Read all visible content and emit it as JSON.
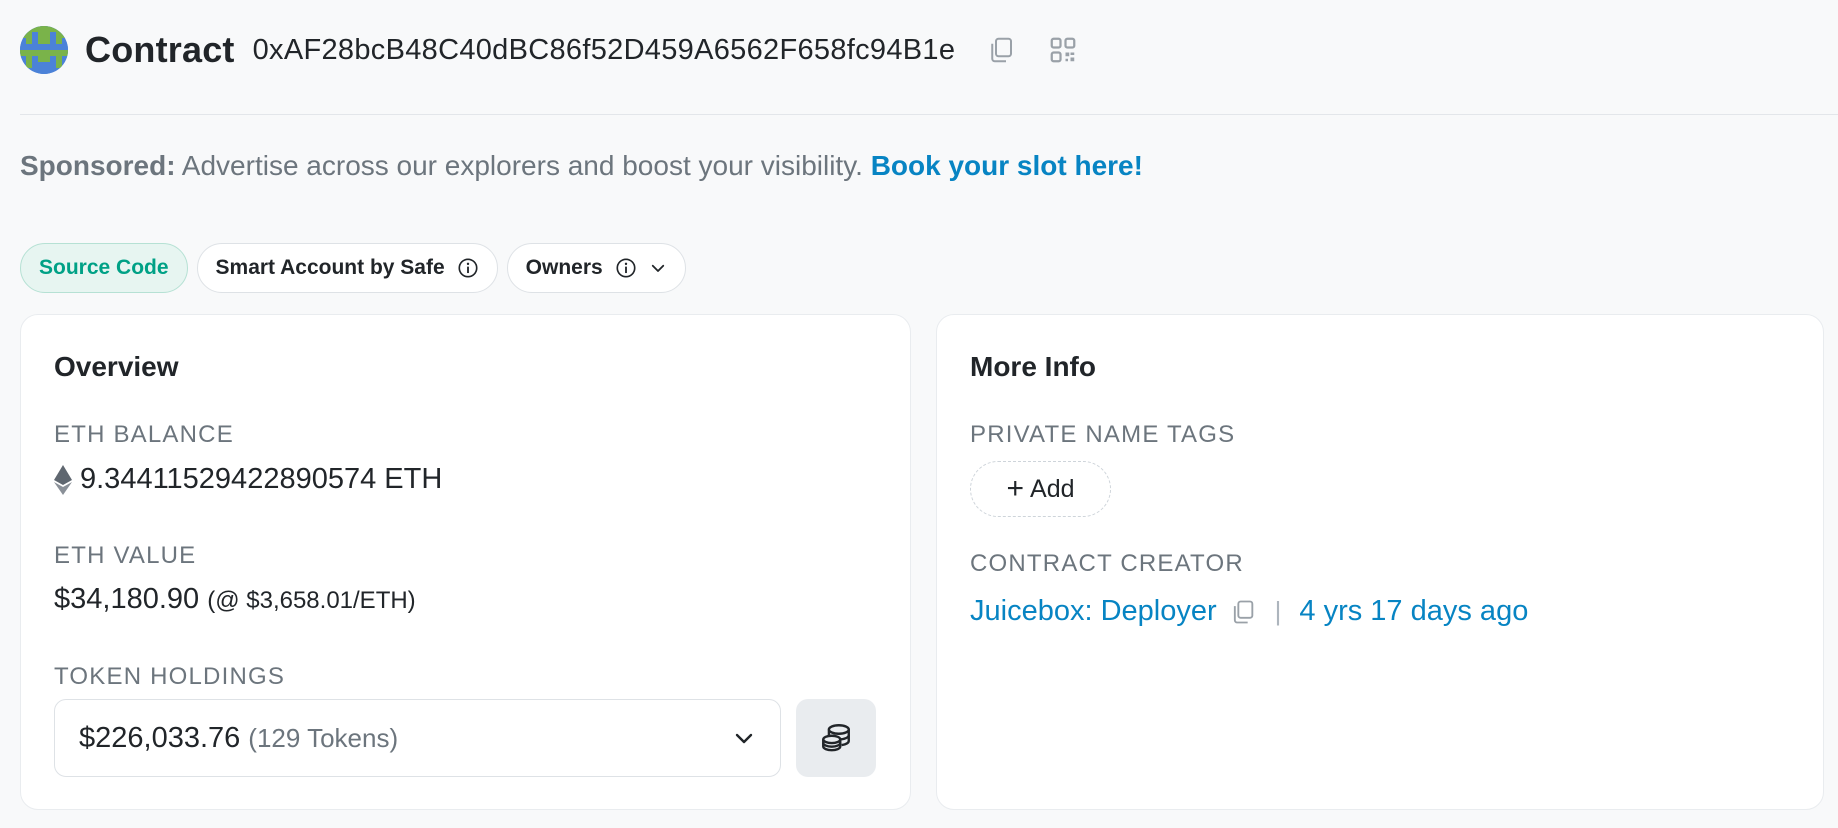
{
  "header": {
    "title": "Contract",
    "address": "0xAF28bcB48C40dBC86f52D459A6562F658fc94B1e"
  },
  "sponsored": {
    "lead": "Sponsored:",
    "text": " Advertise across our explorers and boost your visibility. ",
    "cta": "Book your slot here!"
  },
  "tags": [
    {
      "label": "Source Code"
    },
    {
      "label": "Smart Account by Safe"
    },
    {
      "label": "Owners"
    }
  ],
  "overview": {
    "title": "Overview",
    "eth_balance_label": "ETH BALANCE",
    "eth_balance_value": "9.34411529422890574 ETH",
    "eth_value_label": "ETH VALUE",
    "eth_value_value": "$34,180.90",
    "eth_value_rate": "(@ $3,658.01/ETH)",
    "token_holdings_label": "TOKEN HOLDINGS",
    "token_holdings_value": "$226,033.76",
    "token_holdings_count": "(129 Tokens)"
  },
  "more_info": {
    "title": "More Info",
    "private_tags_label": "PRIVATE NAME TAGS",
    "add_label": "Add",
    "creator_label": "CONTRACT CREATOR",
    "creator_name": "Juicebox: Deployer",
    "creator_sep": "|",
    "creator_age": "4 yrs 17 days ago"
  },
  "colors": {
    "link": "#0784c3",
    "success": "#00a186",
    "muted": "#6c757d"
  },
  "icons": [
    "copy-icon",
    "qr-code-icon",
    "info-icon",
    "chevron-down-icon",
    "ethereum-icon",
    "coin-stack-icon",
    "plus-icon"
  ]
}
